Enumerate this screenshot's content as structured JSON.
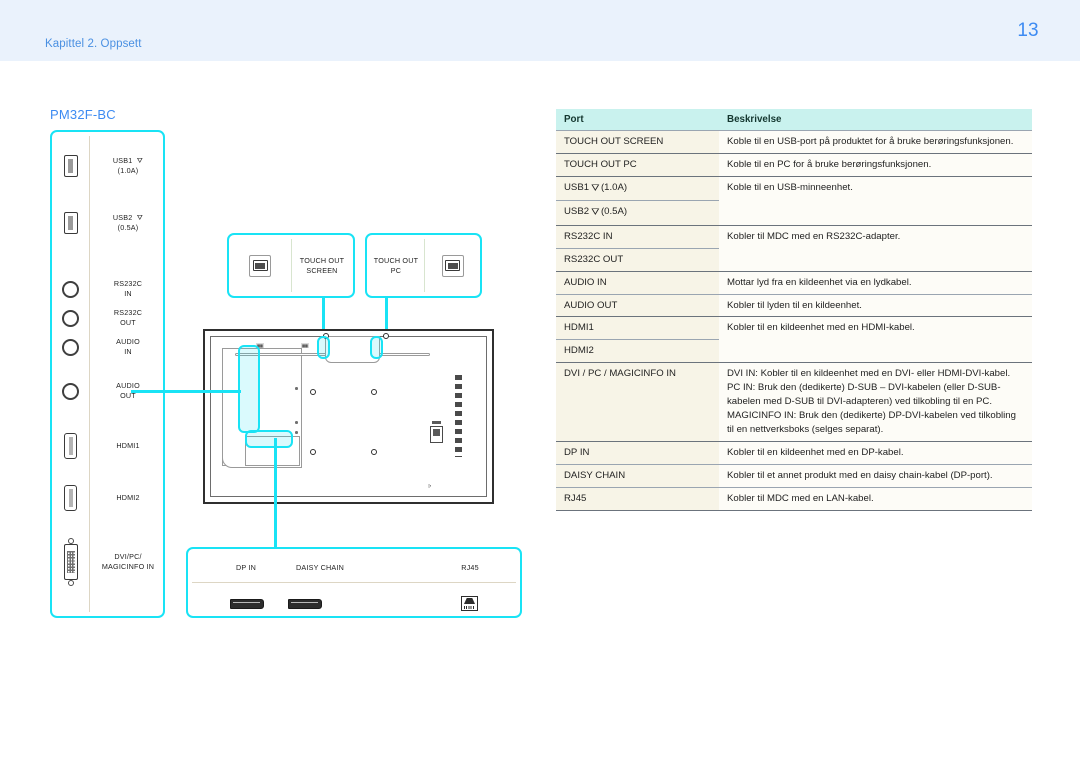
{
  "header": {
    "chapter": "Kapittel 2. Oppsett",
    "page_number": "13",
    "band_color": "#eaf2fc",
    "accent_color": "#3d8bf2"
  },
  "diagram": {
    "model_title": "PM32F-BC",
    "highlight_color": "#19e3f5",
    "side_panel_ports": [
      {
        "icon": "usb-port-icon",
        "label": "USB1 ←•\n(1.0A)",
        "line1": "USB1",
        "line2": "(1.0A)"
      },
      {
        "icon": "usb-port-icon",
        "label": "USB2 (0.5A)",
        "line1": "USB2",
        "line2": "(0.5A)"
      },
      {
        "icon": "audio-jack-icon",
        "label": "RS232C IN",
        "line1": "RS232C",
        "line2": "IN"
      },
      {
        "icon": "audio-jack-icon",
        "label": "RS232C OUT",
        "line1": "RS232C",
        "line2": "OUT"
      },
      {
        "icon": "audio-jack-icon",
        "label": "AUDIO IN",
        "line1": "AUDIO",
        "line2": "IN"
      },
      {
        "icon": "audio-jack-icon",
        "label": "AUDIO OUT",
        "line1": "AUDIO",
        "line2": "OUT"
      },
      {
        "icon": "hdmi-port-icon",
        "label": "HDMI1",
        "line1": "HDMI1",
        "line2": ""
      },
      {
        "icon": "hdmi-port-icon",
        "label": "HDMI2",
        "line1": "HDMI2",
        "line2": ""
      },
      {
        "icon": "dvi-port-icon",
        "label": "DVI/PC/ MAGICINFO IN",
        "line1": "DVI/PC/",
        "line2": "MAGICINFO IN"
      }
    ],
    "touch_boxes": [
      {
        "line1": "TOUCH OUT",
        "line2": "SCREEN"
      },
      {
        "line1": "TOUCH OUT",
        "line2": "PC"
      }
    ],
    "bottom_panel_ports": [
      {
        "label": "DP IN",
        "icon": "displayport-icon"
      },
      {
        "label": "DAISY CHAIN",
        "icon": "displayport-icon"
      },
      {
        "label": "RJ45",
        "icon": "rj45-icon"
      }
    ]
  },
  "table": {
    "columns": [
      "Port",
      "Beskrivelse"
    ],
    "rows": [
      {
        "ports": [
          "TOUCH OUT SCREEN"
        ],
        "desc": [
          "Koble til en USB-port på produktet for å bruke berøringsfunksjonen."
        ]
      },
      {
        "ports": [
          "TOUCH OUT PC"
        ],
        "desc": [
          "Koble til en PC for å bruke berøringsfunksjonen."
        ]
      },
      {
        "ports": [
          "USB1 (1.0A)",
          "USB2 (0.5A)"
        ],
        "port_parts": [
          {
            "pre": "USB1",
            "usb_icon": "usb-trident-icon",
            "post": "(1.0A)"
          },
          {
            "pre": "USB2",
            "usb_icon": "usb-trident-icon",
            "post": "(0.5A)"
          }
        ],
        "desc": [
          "Koble til en USB-minneenhet."
        ]
      },
      {
        "ports": [
          "RS232C IN",
          "RS232C OUT"
        ],
        "desc": [
          "Kobler til MDC med en RS232C-adapter."
        ]
      },
      {
        "ports": [
          "AUDIO IN"
        ],
        "desc": [
          "Mottar lyd fra en kildeenhet via en lydkabel."
        ]
      },
      {
        "ports": [
          "AUDIO OUT"
        ],
        "desc": [
          "Kobler til lyden til en kildeenhet."
        ]
      },
      {
        "ports": [
          "HDMI1",
          "HDMI2"
        ],
        "desc": [
          "Kobler til en kildeenhet med en HDMI-kabel."
        ]
      },
      {
        "ports": [
          "DVI / PC / MAGICINFO IN"
        ],
        "desc": [
          "DVI IN: Kobler til en kildeenhet med en DVI- eller HDMI-DVI-kabel.",
          "PC IN: Bruk den (dedikerte) D-SUB – DVI-kabelen (eller D-SUB-kabelen med D-SUB til DVI-adapteren) ved tilkobling til en PC.",
          "MAGICINFO IN: Bruk den (dedikerte) DP-DVI-kabelen ved tilkobling til en nettverksboks (selges separat)."
        ]
      },
      {
        "ports": [
          "DP IN"
        ],
        "desc": [
          "Kobler til en kildeenhet med en DP-kabel."
        ]
      },
      {
        "ports": [
          "DAISY CHAIN"
        ],
        "desc": [
          "Kobler til et annet produkt med en daisy chain-kabel (DP-port)."
        ]
      },
      {
        "ports": [
          "RJ45"
        ],
        "desc": [
          "Kobler til MDC med en LAN-kabel."
        ]
      }
    ]
  }
}
